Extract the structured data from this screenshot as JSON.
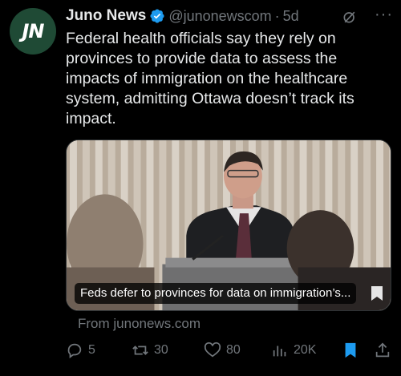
{
  "author": {
    "avatar_text": "JN",
    "name": "Juno News",
    "handle": "@junonewscom",
    "separator": "·",
    "time": "5d",
    "verified_icon": "verified-badge-icon",
    "brand_color": "#1f4a35",
    "verified_color": "#1d9bf0"
  },
  "tweet": {
    "text": "Federal health officials say they rely on provinces to provide data to assess the impacts of immigration on the healthcare system, admitting Ottawa doesn’t track its impact."
  },
  "card": {
    "caption": "Feds defer to provinces for data on immigration’s...",
    "source": "From junonews.com"
  },
  "actions": {
    "replies": "5",
    "retweets": "30",
    "likes": "80",
    "views": "20K",
    "bookmark_color": "#1d9bf0"
  },
  "icons": [
    "grok-icon",
    "more-icon",
    "reply-icon",
    "retweet-icon",
    "like-icon",
    "views-icon",
    "bookmark-icon",
    "share-icon"
  ]
}
